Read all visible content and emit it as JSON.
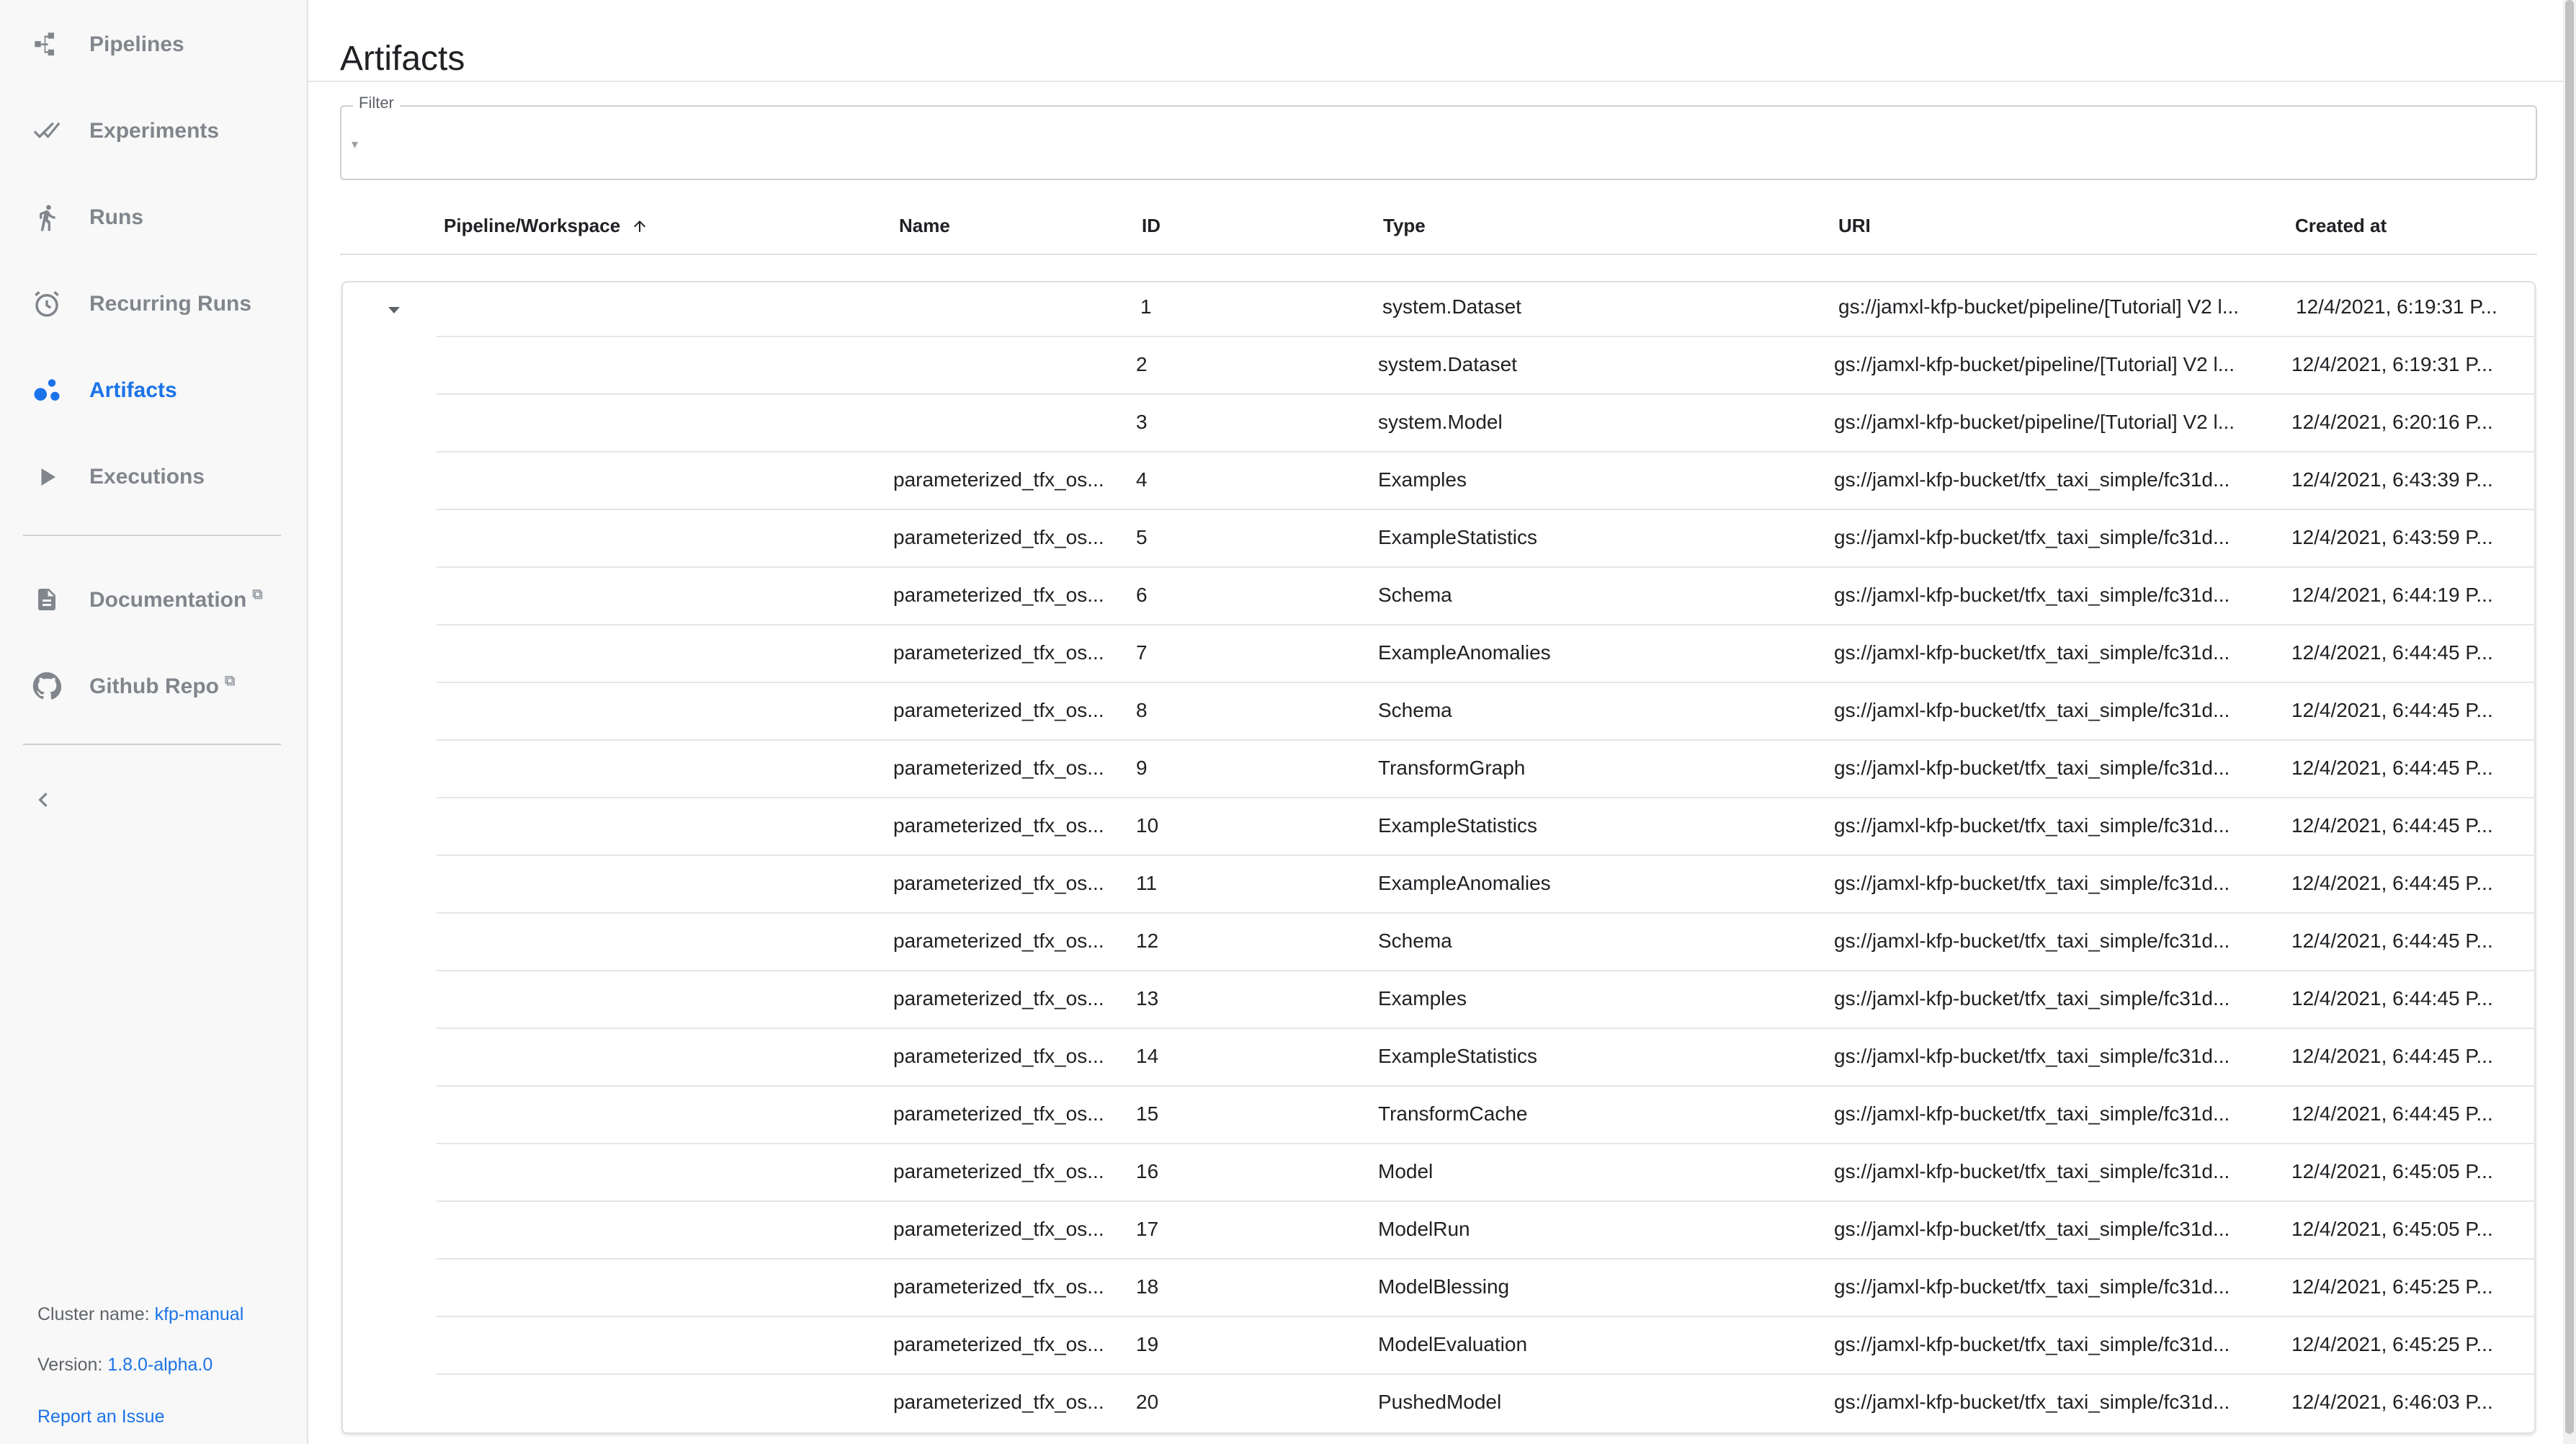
{
  "sidebar": {
    "items": [
      {
        "label": "Pipelines",
        "icon": "pipelines-icon"
      },
      {
        "label": "Experiments",
        "icon": "experiments-icon"
      },
      {
        "label": "Runs",
        "icon": "runs-icon"
      },
      {
        "label": "Recurring Runs",
        "icon": "recurring-runs-icon"
      },
      {
        "label": "Artifacts",
        "icon": "artifacts-icon",
        "active": true
      },
      {
        "label": "Executions",
        "icon": "executions-icon"
      }
    ],
    "external": [
      {
        "label": "Documentation",
        "icon": "documentation-icon"
      },
      {
        "label": "Github Repo",
        "icon": "github-icon"
      }
    ],
    "footer": {
      "cluster_label": "Cluster name:",
      "cluster_value": "kfp-manual",
      "version_label": "Version:",
      "version_value": "1.8.0-alpha.0",
      "report_label": "Report an Issue"
    }
  },
  "page": {
    "title": "Artifacts"
  },
  "filter": {
    "label": "Filter",
    "value": "",
    "placeholder": ""
  },
  "table": {
    "columns": [
      "Pipeline/Workspace",
      "Name",
      "ID",
      "Type",
      "URI",
      "Created at"
    ],
    "sort_column": "Pipeline/Workspace",
    "sort_direction": "ascending",
    "rows": [
      {
        "name": "",
        "id": "1",
        "type": "system.Dataset",
        "uri": "gs://jamxl-kfp-bucket/pipeline/[Tutorial] V2 l...",
        "created": "12/4/2021, 6:19:31 P..."
      },
      {
        "name": "",
        "id": "2",
        "type": "system.Dataset",
        "uri": "gs://jamxl-kfp-bucket/pipeline/[Tutorial] V2 l...",
        "created": "12/4/2021, 6:19:31 P..."
      },
      {
        "name": "",
        "id": "3",
        "type": "system.Model",
        "uri": "gs://jamxl-kfp-bucket/pipeline/[Tutorial] V2 l...",
        "created": "12/4/2021, 6:20:16 P..."
      },
      {
        "name": "parameterized_tfx_os...",
        "id": "4",
        "type": "Examples",
        "uri": "gs://jamxl-kfp-bucket/tfx_taxi_simple/fc31d...",
        "created": "12/4/2021, 6:43:39 P..."
      },
      {
        "name": "parameterized_tfx_os...",
        "id": "5",
        "type": "ExampleStatistics",
        "uri": "gs://jamxl-kfp-bucket/tfx_taxi_simple/fc31d...",
        "created": "12/4/2021, 6:43:59 P..."
      },
      {
        "name": "parameterized_tfx_os...",
        "id": "6",
        "type": "Schema",
        "uri": "gs://jamxl-kfp-bucket/tfx_taxi_simple/fc31d...",
        "created": "12/4/2021, 6:44:19 P..."
      },
      {
        "name": "parameterized_tfx_os...",
        "id": "7",
        "type": "ExampleAnomalies",
        "uri": "gs://jamxl-kfp-bucket/tfx_taxi_simple/fc31d...",
        "created": "12/4/2021, 6:44:45 P..."
      },
      {
        "name": "parameterized_tfx_os...",
        "id": "8",
        "type": "Schema",
        "uri": "gs://jamxl-kfp-bucket/tfx_taxi_simple/fc31d...",
        "created": "12/4/2021, 6:44:45 P..."
      },
      {
        "name": "parameterized_tfx_os...",
        "id": "9",
        "type": "TransformGraph",
        "uri": "gs://jamxl-kfp-bucket/tfx_taxi_simple/fc31d...",
        "created": "12/4/2021, 6:44:45 P..."
      },
      {
        "name": "parameterized_tfx_os...",
        "id": "10",
        "type": "ExampleStatistics",
        "uri": "gs://jamxl-kfp-bucket/tfx_taxi_simple/fc31d...",
        "created": "12/4/2021, 6:44:45 P..."
      },
      {
        "name": "parameterized_tfx_os...",
        "id": "11",
        "type": "ExampleAnomalies",
        "uri": "gs://jamxl-kfp-bucket/tfx_taxi_simple/fc31d...",
        "created": "12/4/2021, 6:44:45 P..."
      },
      {
        "name": "parameterized_tfx_os...",
        "id": "12",
        "type": "Schema",
        "uri": "gs://jamxl-kfp-bucket/tfx_taxi_simple/fc31d...",
        "created": "12/4/2021, 6:44:45 P..."
      },
      {
        "name": "parameterized_tfx_os...",
        "id": "13",
        "type": "Examples",
        "uri": "gs://jamxl-kfp-bucket/tfx_taxi_simple/fc31d...",
        "created": "12/4/2021, 6:44:45 P..."
      },
      {
        "name": "parameterized_tfx_os...",
        "id": "14",
        "type": "ExampleStatistics",
        "uri": "gs://jamxl-kfp-bucket/tfx_taxi_simple/fc31d...",
        "created": "12/4/2021, 6:44:45 P..."
      },
      {
        "name": "parameterized_tfx_os...",
        "id": "15",
        "type": "TransformCache",
        "uri": "gs://jamxl-kfp-bucket/tfx_taxi_simple/fc31d...",
        "created": "12/4/2021, 6:44:45 P..."
      },
      {
        "name": "parameterized_tfx_os...",
        "id": "16",
        "type": "Model",
        "uri": "gs://jamxl-kfp-bucket/tfx_taxi_simple/fc31d...",
        "created": "12/4/2021, 6:45:05 P..."
      },
      {
        "name": "parameterized_tfx_os...",
        "id": "17",
        "type": "ModelRun",
        "uri": "gs://jamxl-kfp-bucket/tfx_taxi_simple/fc31d...",
        "created": "12/4/2021, 6:45:05 P..."
      },
      {
        "name": "parameterized_tfx_os...",
        "id": "18",
        "type": "ModelBlessing",
        "uri": "gs://jamxl-kfp-bucket/tfx_taxi_simple/fc31d...",
        "created": "12/4/2021, 6:45:25 P..."
      },
      {
        "name": "parameterized_tfx_os...",
        "id": "19",
        "type": "ModelEvaluation",
        "uri": "gs://jamxl-kfp-bucket/tfx_taxi_simple/fc31d...",
        "created": "12/4/2021, 6:45:25 P..."
      },
      {
        "name": "parameterized_tfx_os...",
        "id": "20",
        "type": "PushedModel",
        "uri": "gs://jamxl-kfp-bucket/tfx_taxi_simple/fc31d...",
        "created": "12/4/2021, 6:46:03 P..."
      }
    ]
  },
  "colors": {
    "accent": "#1a73e8",
    "nav_text": "#81868c",
    "sidebar_bg": "#f8f8f9"
  }
}
